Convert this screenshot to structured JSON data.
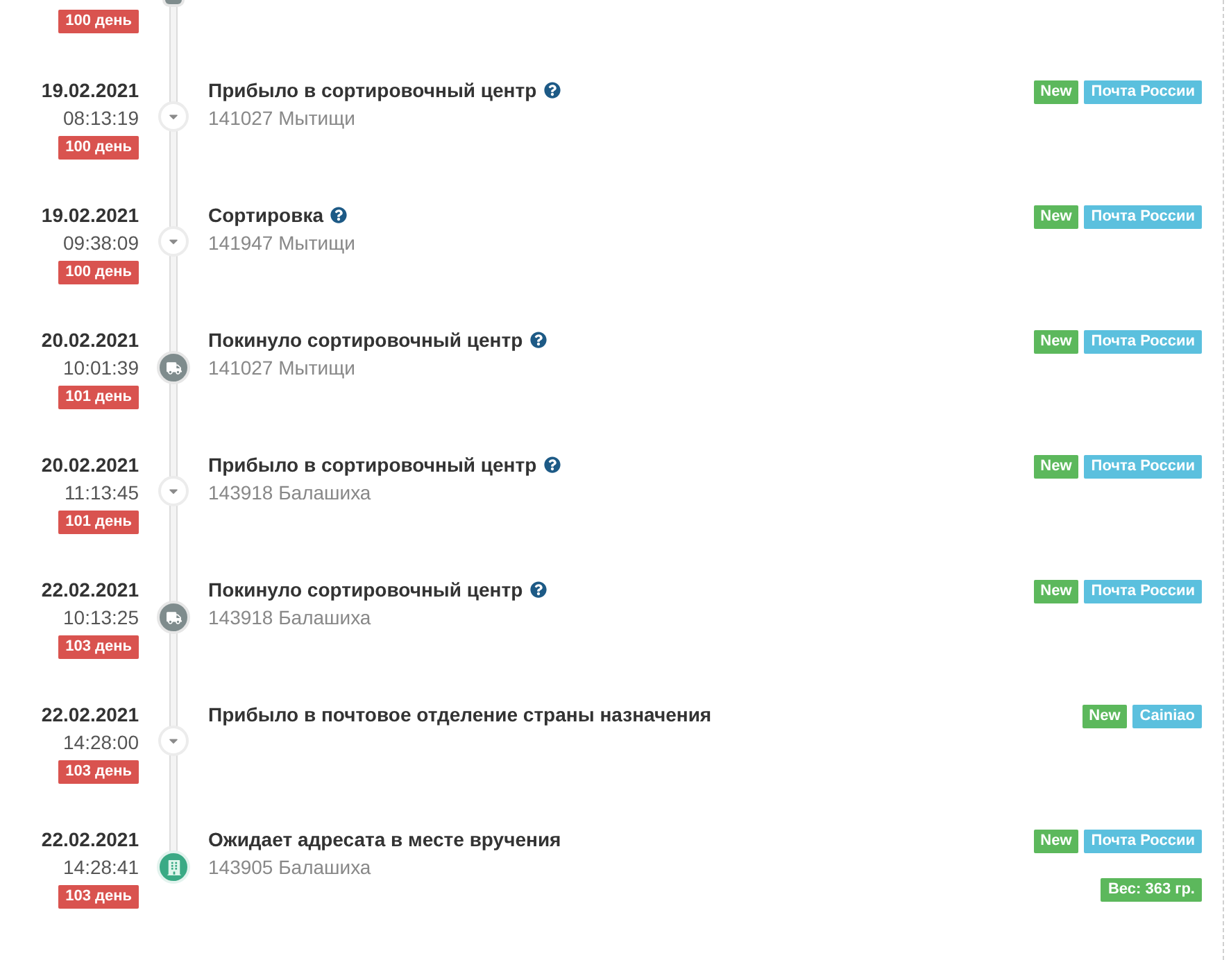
{
  "cut_event": {
    "day": "100 день"
  },
  "events": [
    {
      "date": "19.02.2021",
      "time": "08:13:19",
      "day": "100 день",
      "kind": "arrow",
      "title": "Прибыло в сортировочный центр",
      "help": true,
      "location": "141027 Мытищи",
      "tags": [
        {
          "label": "New",
          "color": "#5cb85c"
        },
        {
          "label": "Почта России",
          "color": "#5bc0de"
        }
      ]
    },
    {
      "date": "19.02.2021",
      "time": "09:38:09",
      "day": "100 день",
      "kind": "arrow",
      "title": "Сортировка",
      "help": true,
      "location": "141947 Мытищи",
      "tags": [
        {
          "label": "New",
          "color": "#5cb85c"
        },
        {
          "label": "Почта России",
          "color": "#5bc0de"
        }
      ]
    },
    {
      "date": "20.02.2021",
      "time": "10:01:39",
      "day": "101 день",
      "kind": "truck",
      "title": "Покинуло сортировочный центр",
      "help": true,
      "location": "141027 Мытищи",
      "tags": [
        {
          "label": "New",
          "color": "#5cb85c"
        },
        {
          "label": "Почта России",
          "color": "#5bc0de"
        }
      ]
    },
    {
      "date": "20.02.2021",
      "time": "11:13:45",
      "day": "101 день",
      "kind": "arrow",
      "title": "Прибыло в сортировочный центр",
      "help": true,
      "location": "143918 Балашиха",
      "tags": [
        {
          "label": "New",
          "color": "#5cb85c"
        },
        {
          "label": "Почта России",
          "color": "#5bc0de"
        }
      ]
    },
    {
      "date": "22.02.2021",
      "time": "10:13:25",
      "day": "103 день",
      "kind": "truck",
      "title": "Покинуло сортировочный центр",
      "help": true,
      "location": "143918 Балашиха",
      "tags": [
        {
          "label": "New",
          "color": "#5cb85c"
        },
        {
          "label": "Почта России",
          "color": "#5bc0de"
        }
      ]
    },
    {
      "date": "22.02.2021",
      "time": "14:28:00",
      "day": "103 день",
      "kind": "arrow",
      "title": "Прибыло в почтовое отделение страны назначения",
      "help": false,
      "tags": [
        {
          "label": "New",
          "color": "#5cb85c"
        },
        {
          "label": "Cainiao",
          "color": "#5bc0de"
        }
      ]
    },
    {
      "date": "22.02.2021",
      "time": "14:28:41",
      "day": "103 день",
      "kind": "building",
      "title": "Ожидает адресата в месте вручения",
      "help": false,
      "location": "143905 Балашиха",
      "tags": [
        {
          "label": "New",
          "color": "#5cb85c"
        },
        {
          "label": "Почта России",
          "color": "#5bc0de"
        }
      ],
      "weight": "Вес: 363 гр."
    }
  ]
}
